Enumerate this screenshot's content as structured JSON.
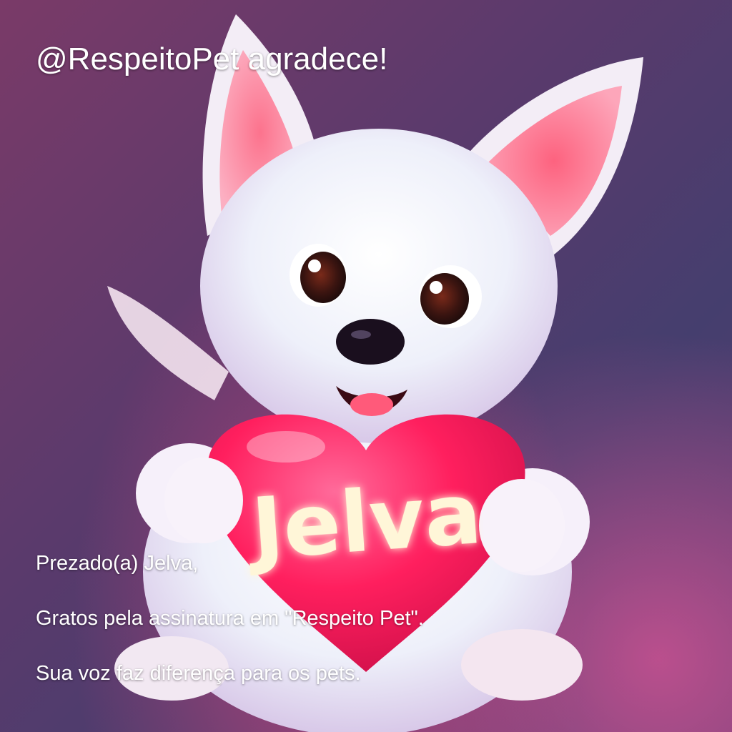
{
  "header": {
    "title": "@RespeitoPet agradece!"
  },
  "heart": {
    "name": "Jelva"
  },
  "message": {
    "greeting": "Prezado(a) Jelva,",
    "thanks": "Gratos pela assinatura em \"Respeito Pet\".",
    "impact": "Sua voz faz diferença para os pets."
  },
  "illustration": {
    "subject": "white-fluffy-puppy-illustration",
    "colors": {
      "fur": "#f2eef8",
      "ear_inner": "#ff5f7e",
      "heart": "#ff1f5e",
      "glow_text": "#fff6d8",
      "background": "#4c3c6c"
    }
  }
}
